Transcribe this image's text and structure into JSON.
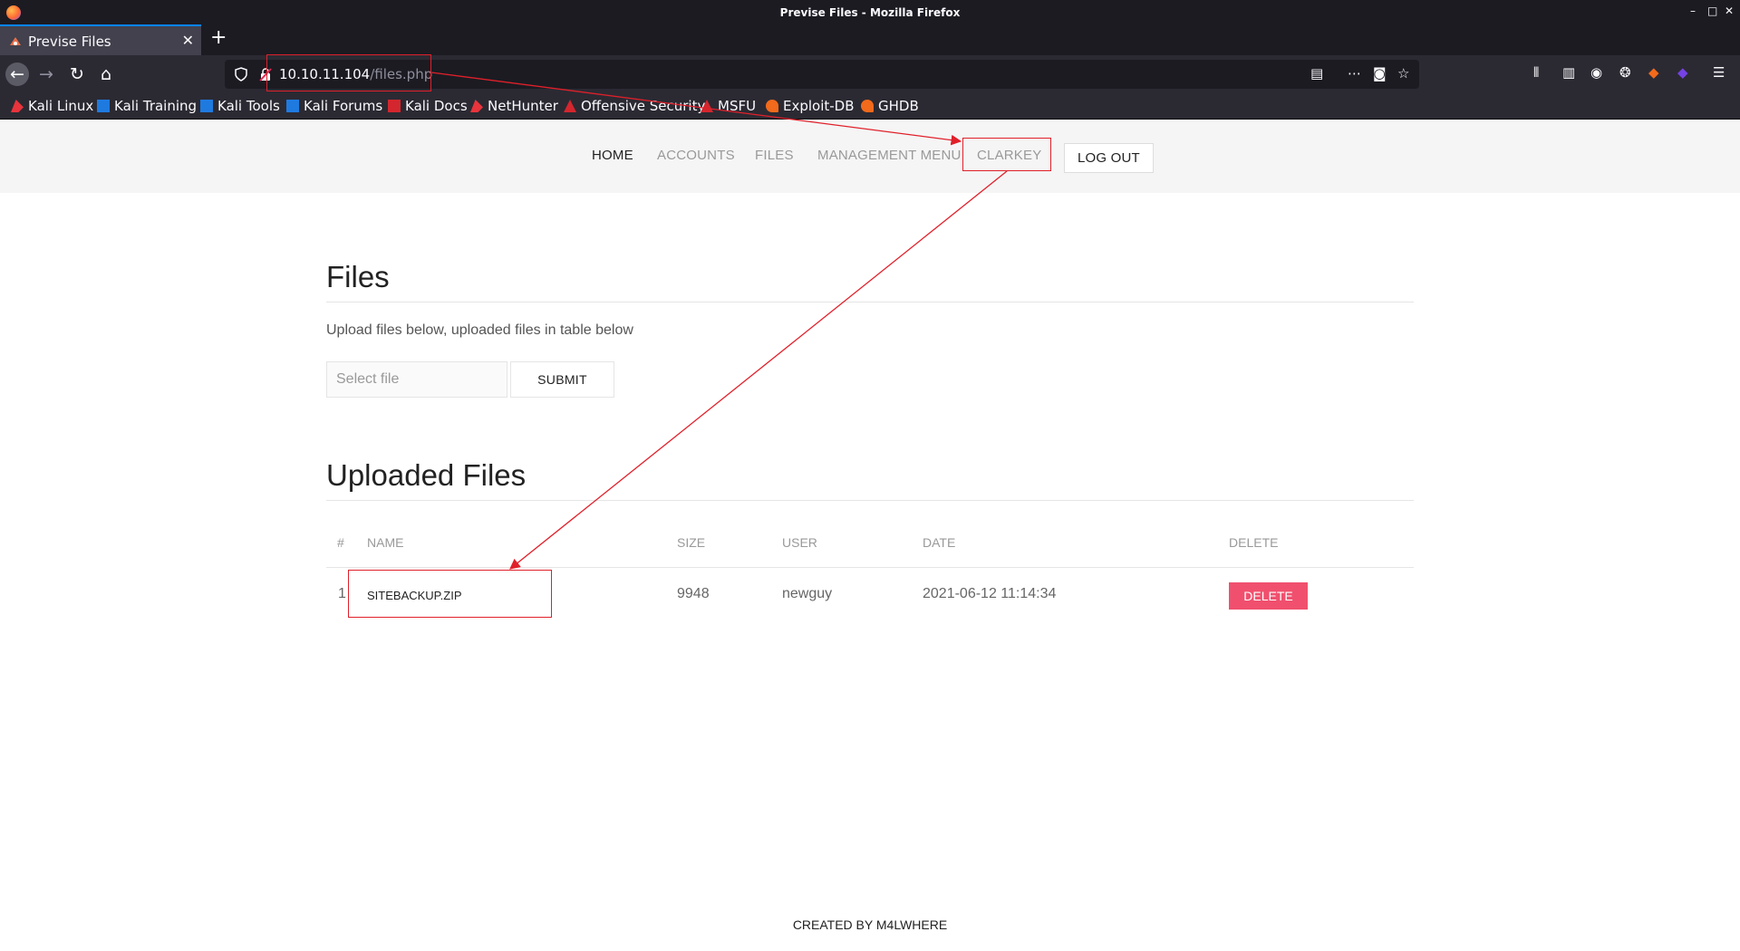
{
  "window": {
    "title": "Previse Files - Mozilla Firefox"
  },
  "tab": {
    "title": "Previse Files",
    "close": "✕"
  },
  "newtab": "+",
  "url": {
    "host": "10.10.11.104",
    "path": "/files.php"
  },
  "bookmarks": [
    {
      "label": "Kali Linux",
      "icon": "kali-dragon-icon",
      "color": "#e8343c"
    },
    {
      "label": "Kali Training",
      "icon": "kali-training-icon",
      "color": "#1f7ae0"
    },
    {
      "label": "Kali Tools",
      "icon": "kali-tools-icon",
      "color": "#1f7ae0"
    },
    {
      "label": "Kali Forums",
      "icon": "kali-forums-icon",
      "color": "#1f7ae0"
    },
    {
      "label": "Kali Docs",
      "icon": "kali-docs-icon",
      "color": "#d4262e"
    },
    {
      "label": "NetHunter",
      "icon": "nethunter-icon",
      "color": "#e8343c"
    },
    {
      "label": "Offensive Security",
      "icon": "offsec-icon",
      "color": "#d4262e"
    },
    {
      "label": "MSFU",
      "icon": "msfu-icon",
      "color": "#d4262e"
    },
    {
      "label": "Exploit-DB",
      "icon": "exploitdb-icon",
      "color": "#f26a1b"
    },
    {
      "label": "GHDB",
      "icon": "ghdb-icon",
      "color": "#f26a1b"
    }
  ],
  "site_nav": {
    "home": "HOME",
    "accounts": "ACCOUNTS",
    "files": "FILES",
    "management": "MANAGEMENT MENU",
    "user": "CLARKEY",
    "logout": "LOG OUT"
  },
  "files_section": {
    "title": "Files",
    "intro": "Upload files below, uploaded files in table below",
    "file_placeholder": "Select file",
    "submit": "SUBMIT"
  },
  "uploaded": {
    "title": "Uploaded Files",
    "columns": [
      "#",
      "NAME",
      "SIZE",
      "USER",
      "DATE",
      "DELETE"
    ],
    "rows": [
      {
        "num": "1",
        "name": "SITEBACKUP.ZIP",
        "size": "9948",
        "user": "newguy",
        "date": "2021-06-12 11:14:34",
        "action": "DELETE"
      }
    ]
  },
  "footer": "CREATED BY M4LWHERE",
  "colors": {
    "accent": "#f0506e",
    "annotation": "#e0202a",
    "browser_dark": "#2b2a33"
  }
}
